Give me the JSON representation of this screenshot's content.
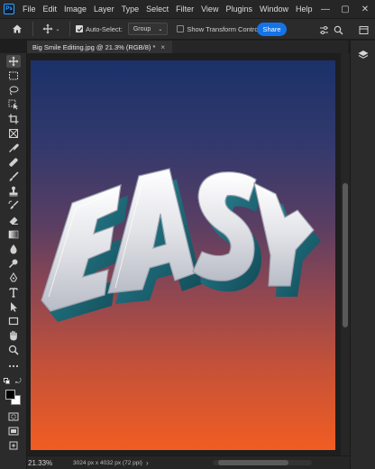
{
  "app": {
    "logo_text": "Ps"
  },
  "menu": {
    "items": [
      "File",
      "Edit",
      "Image",
      "Layer",
      "Type",
      "Select",
      "Filter",
      "View",
      "Plugins",
      "Window",
      "Help"
    ]
  },
  "window_controls": {
    "minimize": "—",
    "maximize": "▢",
    "close": "✕"
  },
  "options_bar": {
    "auto_select_label": "Auto-Select:",
    "auto_select_checked": true,
    "auto_select_target": "Group",
    "transform_controls_label": "Show Transform Controls",
    "transform_controls_checked": false,
    "share_label": "Share"
  },
  "document": {
    "tab_title": "Big Smile Editing.jpg @ 21.3% (RGB/8) *",
    "tab_close": "×",
    "artwork_text": "EASY"
  },
  "toolbar": {
    "tools": [
      {
        "name": "move-tool",
        "active": true
      },
      {
        "name": "rectangular-marquee-tool"
      },
      {
        "name": "lasso-tool"
      },
      {
        "name": "object-selection-tool"
      },
      {
        "name": "crop-tool"
      },
      {
        "name": "frame-tool"
      },
      {
        "name": "eyedropper-tool"
      },
      {
        "name": "spot-healing-brush-tool"
      },
      {
        "name": "brush-tool"
      },
      {
        "name": "clone-stamp-tool"
      },
      {
        "name": "history-brush-tool"
      },
      {
        "name": "eraser-tool"
      },
      {
        "name": "gradient-tool"
      },
      {
        "name": "blur-tool"
      },
      {
        "name": "dodge-tool"
      },
      {
        "name": "pen-tool"
      },
      {
        "name": "type-tool"
      },
      {
        "name": "path-selection-tool"
      },
      {
        "name": "rectangle-tool"
      },
      {
        "name": "hand-tool"
      },
      {
        "name": "zoom-tool"
      },
      {
        "name": "edit-toolbar"
      }
    ],
    "foreground_color": "#000000",
    "background_color": "#ffffff"
  },
  "status": {
    "zoom": "21.33%",
    "dimensions": "3024 px x 4032 px (72 ppi)",
    "arrow": "›"
  },
  "colors": {
    "accent": "#1473e6",
    "canvas_top": "#1b3169",
    "canvas_bottom": "#f15d22",
    "letter_face": "#e8e8ea",
    "letter_side": "#1d6b7a"
  }
}
